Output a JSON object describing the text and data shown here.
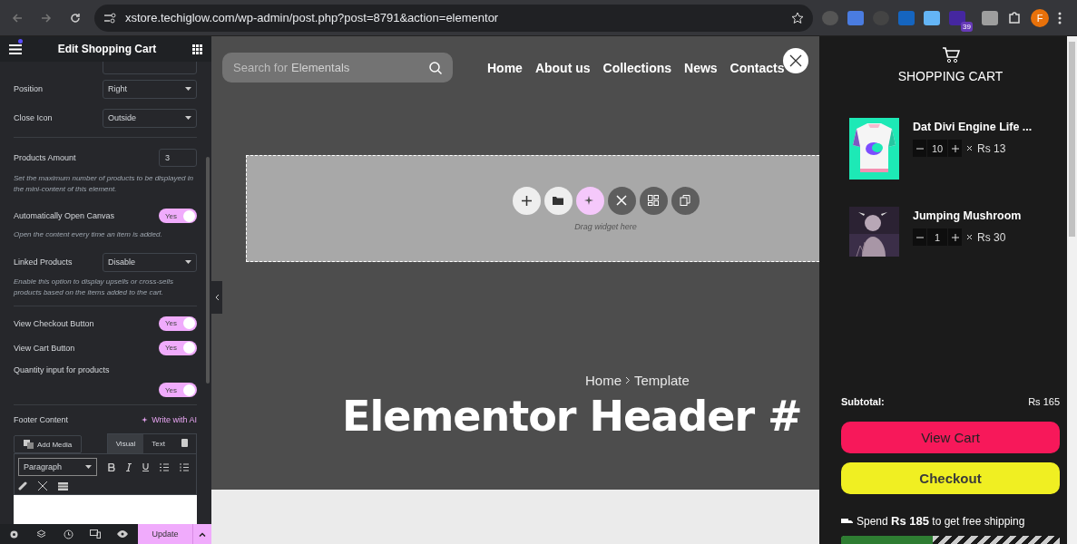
{
  "browser": {
    "url": "xstore.techiglow.com/wp-admin/post.php?post=8791&action=elementor",
    "extension_badge": "39",
    "profile_initial": "F"
  },
  "editor": {
    "title": "Edit Shopping Cart",
    "settings": [
      {
        "kind": "select",
        "label": "Position",
        "value": "Right"
      },
      {
        "kind": "select",
        "label": "Close Icon",
        "value": "Outside"
      },
      {
        "kind": "divider"
      },
      {
        "kind": "number",
        "label": "Products Amount",
        "value": "3",
        "help": "Set the maximum number of products to be displayed in the mini-content of this element."
      },
      {
        "kind": "toggle",
        "label": "Automatically Open Canvas",
        "on": true,
        "toggle_text": "Yes",
        "help": "Open the content every time an item is added."
      },
      {
        "kind": "select",
        "label": "Linked Products",
        "value": "Disable",
        "help": "Enable this option to display upsells or cross-sells products based on the items added to the cart."
      },
      {
        "kind": "divider"
      },
      {
        "kind": "toggle",
        "label": "View Checkout Button",
        "on": true,
        "toggle_text": "Yes"
      },
      {
        "kind": "toggle",
        "label": "View Cart Button",
        "on": true,
        "toggle_text": "Yes"
      },
      {
        "kind": "toggle_below",
        "label": "Quantity input for products",
        "on": true,
        "toggle_text": "Yes"
      },
      {
        "kind": "divider"
      }
    ],
    "footer_content": {
      "label": "Footer Content",
      "ai_link": "Write with AI",
      "add_media": "Add Media",
      "tabs": [
        {
          "label": "Visual",
          "selected": true
        },
        {
          "label": "Text",
          "selected": false
        }
      ],
      "format": "Paragraph"
    },
    "update_button": "Update"
  },
  "canvas": {
    "search": {
      "placeholder": "Search for",
      "rotating_word": "Elementals"
    },
    "nav": [
      "Home",
      "About us",
      "Collections",
      "News",
      "Contacts"
    ],
    "drop_hint": "Drag widget here",
    "breadcrumb": [
      "Home",
      "Template"
    ],
    "heading": "Elementor Header #"
  },
  "cart": {
    "title": "SHOPPING CART",
    "items": [
      {
        "name": "Dat Divi Engine Life ...",
        "qty": "10",
        "price": "Rs 13"
      },
      {
        "name": "Jumping Mushroom",
        "qty": "1",
        "price": "Rs 30"
      }
    ],
    "subtotal_label": "Subtotal:",
    "subtotal": "Rs 165",
    "view_cart": "View Cart",
    "checkout": "Checkout",
    "shipping": "Spend **Rs 185** to get free shipping",
    "shipping_progress": {
      "level": 0.42
    }
  }
}
